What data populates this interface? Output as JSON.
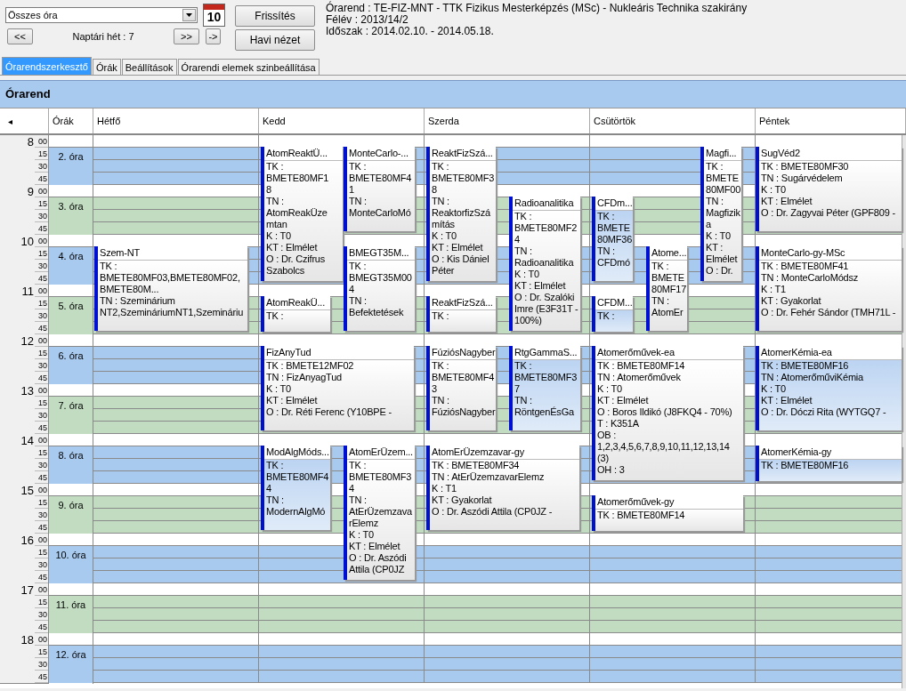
{
  "toolbar": {
    "filter": {
      "value": "Összes óra"
    },
    "calendar_day": "10",
    "prev_button": "<<",
    "week_label": "Naptári hét : 7",
    "next_button": ">>",
    "go_button": "->",
    "refresh_button": "Frissítés",
    "month_view_button": "Havi nézet",
    "info": [
      "Órarend : TE-FIZ-MNT - TTK Fizikus Mesterképzés (MSc) - Nukleáris Technika szakirány",
      "Félév : 2013/14/2",
      "Időszak : 2014.02.10. - 2014.05.18."
    ]
  },
  "tabs": [
    {
      "label": "Órarendszerkesztő",
      "selected": true
    },
    {
      "label": "Órák",
      "selected": false
    },
    {
      "label": "Beállítások",
      "selected": false
    },
    {
      "label": "Órarendi elemek szinbeállítása",
      "selected": false
    }
  ],
  "panel_title": "Órarend",
  "header": {
    "collapse": "◂",
    "periods": "Órák",
    "days": [
      "Hétfő",
      "Kedd",
      "Szerda",
      "Csütörtök",
      "Péntek"
    ]
  },
  "hours": [
    {
      "hour": "8",
      "minutes": [
        "00",
        "15",
        "30",
        "45"
      ],
      "period": "2. óra",
      "color": "#a9caef"
    },
    {
      "hour": "9",
      "minutes": [
        "00",
        "15",
        "30",
        "45"
      ],
      "period": "3. óra",
      "color": "#c1dcc1"
    },
    {
      "hour": "10",
      "minutes": [
        "00",
        "15",
        "30",
        "45"
      ],
      "period": "4. óra",
      "color": "#a9caef"
    },
    {
      "hour": "11",
      "minutes": [
        "00",
        "15",
        "30",
        "45"
      ],
      "period": "5. óra",
      "color": "#c1dcc1"
    },
    {
      "hour": "12",
      "minutes": [
        "00",
        "15",
        "30",
        "45"
      ],
      "period": "6. óra",
      "color": "#a9caef"
    },
    {
      "hour": "13",
      "minutes": [
        "00",
        "15",
        "30",
        "45"
      ],
      "period": "7. óra",
      "color": "#c1dcc1"
    },
    {
      "hour": "14",
      "minutes": [
        "00",
        "15",
        "30",
        "45"
      ],
      "period": "8. óra",
      "color": "#a9caef"
    },
    {
      "hour": "15",
      "minutes": [
        "00",
        "15",
        "30",
        "45"
      ],
      "period": "9. óra",
      "color": "#c1dcc1"
    },
    {
      "hour": "16",
      "minutes": [
        "00",
        "15",
        "30",
        "45"
      ],
      "period": "10. óra",
      "color": "#a9caef"
    },
    {
      "hour": "17",
      "minutes": [
        "00",
        "15",
        "30",
        "45"
      ],
      "period": "11. óra",
      "color": "#c1dcc1"
    },
    {
      "hour": "18",
      "minutes": [
        "00",
        "15",
        "30",
        "45"
      ],
      "period": "12. óra",
      "color": "#a9caef"
    }
  ],
  "events": [
    {
      "title": "Szem-NT",
      "highlighted": false,
      "lines": [
        "TK :",
        "BMETE80MF03,BMETE80MF02,",
        "BMETE80M...",
        "TN : Szeminárium",
        "NT2,SzemináriumNT1,Szemináriu"
      ]
    },
    {
      "title": "AtomReaktÜ...",
      "highlighted": false,
      "lines": [
        "TK :",
        "BMETE80MF1",
        "8",
        "TN :",
        "AtomReakÜze",
        "mtan",
        "K : T0",
        "KT : Elmélet",
        "O :  Dr. Czifrus",
        "Szabolcs"
      ]
    },
    {
      "title": "MonteCarlo-...",
      "highlighted": false,
      "lines": [
        "TK :",
        "BMETE80MF4",
        "1",
        "TN :",
        "MonteCarloMó"
      ]
    },
    {
      "title": "AtomReakÜ...",
      "highlighted": false,
      "lines": [
        "TK :"
      ]
    },
    {
      "title": "BMEGT35M...",
      "highlighted": false,
      "lines": [
        "TK :",
        "BMEGT35M00",
        "4",
        "TN :",
        "Befektetések"
      ]
    },
    {
      "title": "FizAnyTud",
      "highlighted": false,
      "lines": [
        "TK : BMETE12MF02",
        "TN : FizAnyagTud",
        "K : T0",
        "KT : Elmélet",
        "O :  Dr. Réti Ferenc (Y10BPE -"
      ]
    },
    {
      "title": "ModAlgMóds...",
      "highlighted": true,
      "lines": [
        "TK :",
        "BMETE80MF4",
        "4",
        "TN :",
        "ModernAlgMó"
      ]
    },
    {
      "title": "AtomErÜzem...",
      "highlighted": false,
      "lines": [
        "TK :",
        "BMETE80MF3",
        "4",
        "TN :",
        "AtErÜzemzava",
        "rElemz",
        "K : T0",
        "KT : Elmélet",
        "O :  Dr. Aszódi",
        "Attila (CP0JZ"
      ]
    },
    {
      "title": "ReaktFizSzá...",
      "highlighted": false,
      "lines": [
        "TK :",
        "BMETE80MF3",
        "8",
        "TN :",
        "ReaktorfizSzá",
        "mítás",
        "K : T0",
        "KT : Elmélet",
        "O :  Kis Dániel",
        "Péter"
      ]
    },
    {
      "title": "ReaktFizSzá...",
      "highlighted": false,
      "lines": [
        "TK :"
      ]
    },
    {
      "title": "Radioanalitika",
      "highlighted": false,
      "lines": [
        "TK :",
        "BMETE80MF2",
        "4",
        "TN :",
        "Radioanalitika",
        "K : T0",
        "KT : Elmélet",
        "O :  Dr. Szalóki",
        "Imre (E3F31T -",
        "100%)"
      ]
    },
    {
      "title": "FúziósNagyber",
      "highlighted": false,
      "lines": [
        "TK :",
        "BMETE80MF4",
        "3",
        "TN :",
        "FúziósNagyber"
      ]
    },
    {
      "title": "RtgGammaS...",
      "highlighted": true,
      "lines": [
        "TK :",
        "BMETE80MF3",
        "7",
        "TN :",
        "RöntgenÉsGa"
      ]
    },
    {
      "title": "AtomErÜzemzavar-gy",
      "highlighted": false,
      "lines": [
        "TK : BMETE80MF34",
        "TN : AtErÜzemzavarElemz",
        "K : T1",
        "KT : Gyakorlat",
        "O :  Dr. Aszódi Attila (CP0JZ -"
      ]
    },
    {
      "title": "CFDm...",
      "highlighted": true,
      "lines": [
        "TK :",
        "BMETE",
        "80MF36",
        "TN :",
        "CFDmó"
      ]
    },
    {
      "title": "CFDM...",
      "highlighted": true,
      "lines": [
        "TK :"
      ]
    },
    {
      "title": "Atome...",
      "highlighted": false,
      "lines": [
        "TK :",
        "BMETE",
        "80MF17",
        "TN :",
        "AtomEr"
      ]
    },
    {
      "title": "Magfi...",
      "highlighted": false,
      "lines": [
        "TK :",
        "BMETE",
        "80MF00",
        "TN :",
        "Magfizik",
        "a",
        "K : T0",
        "KT :",
        "Elmélet",
        "O :  Dr."
      ]
    },
    {
      "title": "Atomerőművek-ea",
      "highlighted": false,
      "lines": [
        "TK : BMETE80MF14",
        "TN : Atomerőművek",
        "K : T0",
        "KT : Elmélet",
        "O :  Boros Ildikó (J8FKQ4 - 70%)",
        "T : K351A",
        "OB :",
        "1,2,3,4,5,6,7,8,9,10,11,12,13,14",
        "(3)",
        "OH : 3"
      ]
    },
    {
      "title": "Atomerőművek-gy",
      "highlighted": false,
      "lines": [
        "TK : BMETE80MF14"
      ]
    },
    {
      "title": "SugVéd2",
      "highlighted": false,
      "lines": [
        "TK : BMETE80MF30",
        "TN : Sugárvédelem",
        "K : T0",
        "KT : Elmélet",
        "O :  Dr. Zagyvai Péter (GPF809 -"
      ]
    },
    {
      "title": "MonteCarlo-gy-MSc",
      "highlighted": false,
      "lines": [
        "TK : BMETE80MF41",
        "TN : MonteCarloMódsz",
        "K : T1",
        "KT : Gyakorlat",
        "O :  Dr. Fehér Sándor (TMH71L -"
      ]
    },
    {
      "title": "AtomerKémia-ea",
      "highlighted": true,
      "lines": [
        "TK : BMETE80MF16",
        "TN : AtomerőműviKémia",
        "K : T0",
        "KT : Elmélet",
        "O :  Dr. Dóczi  Rita (WYTGQ7 -"
      ]
    },
    {
      "title": "AtomerKémia-gy",
      "highlighted": true,
      "lines": [
        "TK : BMETE80MF16"
      ]
    }
  ]
}
